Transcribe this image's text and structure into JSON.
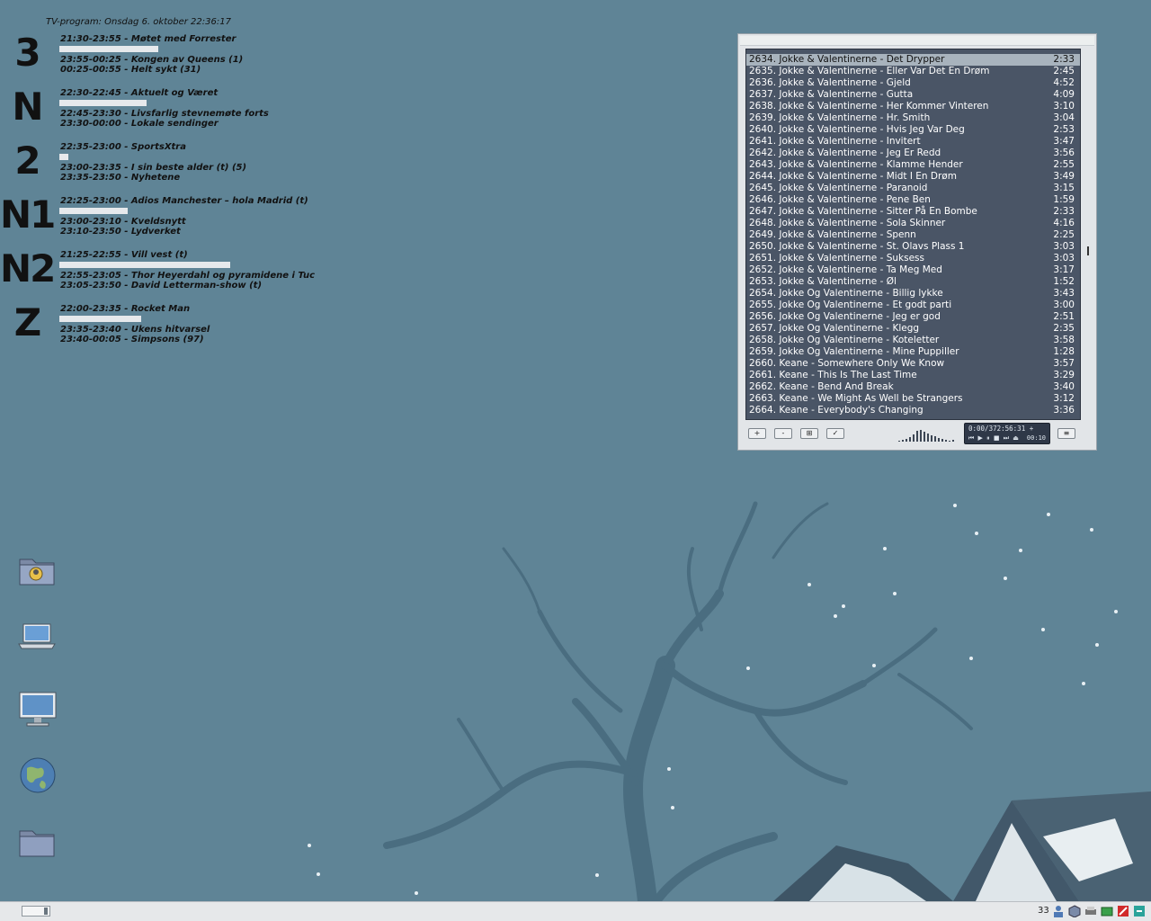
{
  "tv_program": {
    "title": "TV-program: Onsdag 6. oktober 22:36:17",
    "channels": [
      {
        "logo": "3",
        "progress": 0.58,
        "current": "21:30-23:55 - Møtet med Forrester",
        "next1": "23:55-00:25 - Kongen av Queens (1)",
        "next2": "00:25-00:55 - Helt sykt (31)"
      },
      {
        "logo": "N",
        "progress": 0.51,
        "current": "22:30-22:45 - Aktuelt og Været",
        "next1": "22:45-23:30 - Livsfarlig stevnemøte forts",
        "next2": "23:30-00:00 - Lokale sendinger"
      },
      {
        "logo": "2",
        "progress": 0.05,
        "current": "22:35-23:00 - SportsXtra",
        "next1": "23:00-23:35 - I sin beste alder (t)  (5)",
        "next2": "23:35-23:50 - Nyhetene"
      },
      {
        "logo": "N1",
        "progress": 0.4,
        "current": "22:25-23:00 - Adios Manchester – hola Madrid (t)",
        "next1": "23:00-23:10 - Kveldsnytt",
        "next2": "23:10-23:50 - Lydverket"
      },
      {
        "logo": "N2",
        "progress": 1.0,
        "current": "21:25-22:55 - Vill vest (t)",
        "next1": "22:55-23:05 - Thor Heyerdahl og pyramidene i Tuc",
        "next2": "23:05-23:50 - David Letterman-show (t)"
      },
      {
        "logo": "Z",
        "progress": 0.48,
        "current": "22:00-23:35 - Rocket Man",
        "next1": "23:35-23:40 - Ukens hitvarsel",
        "next2": "23:40-00:05 - Simpsons (97)"
      }
    ]
  },
  "desktop_icons": [
    {
      "name": "home-folder-icon"
    },
    {
      "name": "laptop-icon"
    },
    {
      "name": "computer-icon"
    },
    {
      "name": "network-globe-icon"
    },
    {
      "name": "folder-icon"
    }
  ],
  "player": {
    "playlist": [
      {
        "title": "2634. Jokke & Valentinerne - Det Drypper",
        "time": "2:33"
      },
      {
        "title": "2635. Jokke & Valentinerne - Eller Var Det En Drøm",
        "time": "2:45"
      },
      {
        "title": "2636. Jokke & Valentinerne - Gjeld",
        "time": "4:52"
      },
      {
        "title": "2637. Jokke & Valentinerne - Gutta",
        "time": "4:09"
      },
      {
        "title": "2638. Jokke & Valentinerne - Her Kommer Vinteren",
        "time": "3:10"
      },
      {
        "title": "2639. Jokke & Valentinerne - Hr. Smith",
        "time": "3:04"
      },
      {
        "title": "2640. Jokke & Valentinerne - Hvis Jeg Var Deg",
        "time": "2:53"
      },
      {
        "title": "2641. Jokke & Valentinerne - Invitert",
        "time": "3:47"
      },
      {
        "title": "2642. Jokke & Valentinerne - Jeg Er Redd",
        "time": "3:56"
      },
      {
        "title": "2643. Jokke & Valentinerne - Klamme Hender",
        "time": "2:55"
      },
      {
        "title": "2644. Jokke & Valentinerne - Midt I En Drøm",
        "time": "3:49"
      },
      {
        "title": "2645. Jokke & Valentinerne - Paranoid",
        "time": "3:15"
      },
      {
        "title": "2646. Jokke & Valentinerne - Pene Ben",
        "time": "1:59"
      },
      {
        "title": "2647. Jokke & Valentinerne - Sitter På En Bombe",
        "time": "2:33"
      },
      {
        "title": "2648. Jokke & Valentinerne - Sola Skinner",
        "time": "4:16"
      },
      {
        "title": "2649. Jokke & Valentinerne - Spenn",
        "time": "2:25"
      },
      {
        "title": "2650. Jokke & Valentinerne - St. Olavs Plass 1",
        "time": "3:03"
      },
      {
        "title": "2651. Jokke & Valentinerne - Suksess",
        "time": "3:03"
      },
      {
        "title": "2652. Jokke & Valentinerne - Ta Meg Med",
        "time": "3:17"
      },
      {
        "title": "2653. Jokke & Valentinerne - Øl",
        "time": "1:52"
      },
      {
        "title": "2654. Jokke Og Valentinerne - Billig lykke",
        "time": "3:43"
      },
      {
        "title": "2655. Jokke Og Valentinerne - Et godt parti",
        "time": "3:00"
      },
      {
        "title": "2656. Jokke Og Valentinerne - Jeg er god",
        "time": "2:51"
      },
      {
        "title": "2657. Jokke Og Valentinerne - Klegg",
        "time": "2:35"
      },
      {
        "title": "2658. Jokke Og Valentinerne - Koteletter",
        "time": "3:58"
      },
      {
        "title": "2659. Jokke Og Valentinerne - Mine Puppiller",
        "time": "1:28"
      },
      {
        "title": "2660. Keane - Somewhere Only We Know",
        "time": "3:57"
      },
      {
        "title": "2661. Keane - This Is The Last Time",
        "time": "3:29"
      },
      {
        "title": "2662. Keane - Bend And Break",
        "time": "3:40"
      },
      {
        "title": "2663. Keane - We Might As Well be Strangers",
        "time": "3:12"
      },
      {
        "title": "2664. Keane - Everybody's Changing",
        "time": "3:36"
      }
    ],
    "current_index": 0,
    "buttons": {
      "add": "+",
      "remove": "-",
      "select": "⊞",
      "misc": "✓",
      "menu": "≡"
    },
    "lcd": {
      "position": "0:00/372:56:31 +",
      "controls": "⏮ ▶ ⏸ ■ ⏭ ⏏",
      "elapsed": "00:10"
    }
  },
  "taskbar": {
    "tray_label": "33",
    "tray_icons": [
      "user-icon",
      "package-icon",
      "printer-icon",
      "battery-icon",
      "flag-icon",
      "network-icon"
    ]
  }
}
